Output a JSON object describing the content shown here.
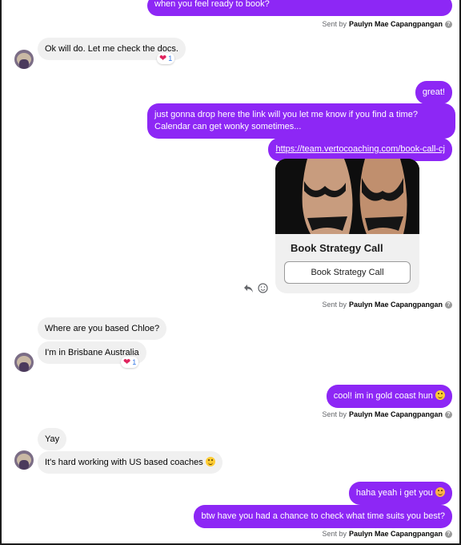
{
  "messages": {
    "m1": "when you feel ready to book?",
    "m2": "Ok will do. Let me check the docs.",
    "m3": "great!",
    "m4": "just gonna drop here the link will you let me know if you find a time? Calendar can get wonky sometimes...",
    "m5": "https://team.vertocoaching.com/book-call-cj",
    "m6": "Where are you based Chloe?",
    "m7": "I'm in Brisbane Australia",
    "m8": "cool! im in gold coast hun",
    "m9": "Yay",
    "m10": "It's hard working with US based coaches",
    "m11": "haha yeah i get you",
    "m12": "btw have you had a chance to check what time suits you best?"
  },
  "sent_by": {
    "prefix": "Sent by",
    "name": "Paulyn Mae Capangpangan",
    "info_icon": "?"
  },
  "reactions": {
    "r1_count": "1",
    "r2_count": "1",
    "heart": "❤"
  },
  "link_card": {
    "title": "Book Strategy Call",
    "button_label": "Book Strategy Call"
  },
  "icons": {
    "reply": "reply-icon",
    "react": "smiley-icon",
    "info": "info-icon"
  },
  "colors": {
    "outgoing_bubble": "#8d27f5",
    "incoming_bubble": "#f0f0f0",
    "reaction_count": "#3578e5"
  }
}
